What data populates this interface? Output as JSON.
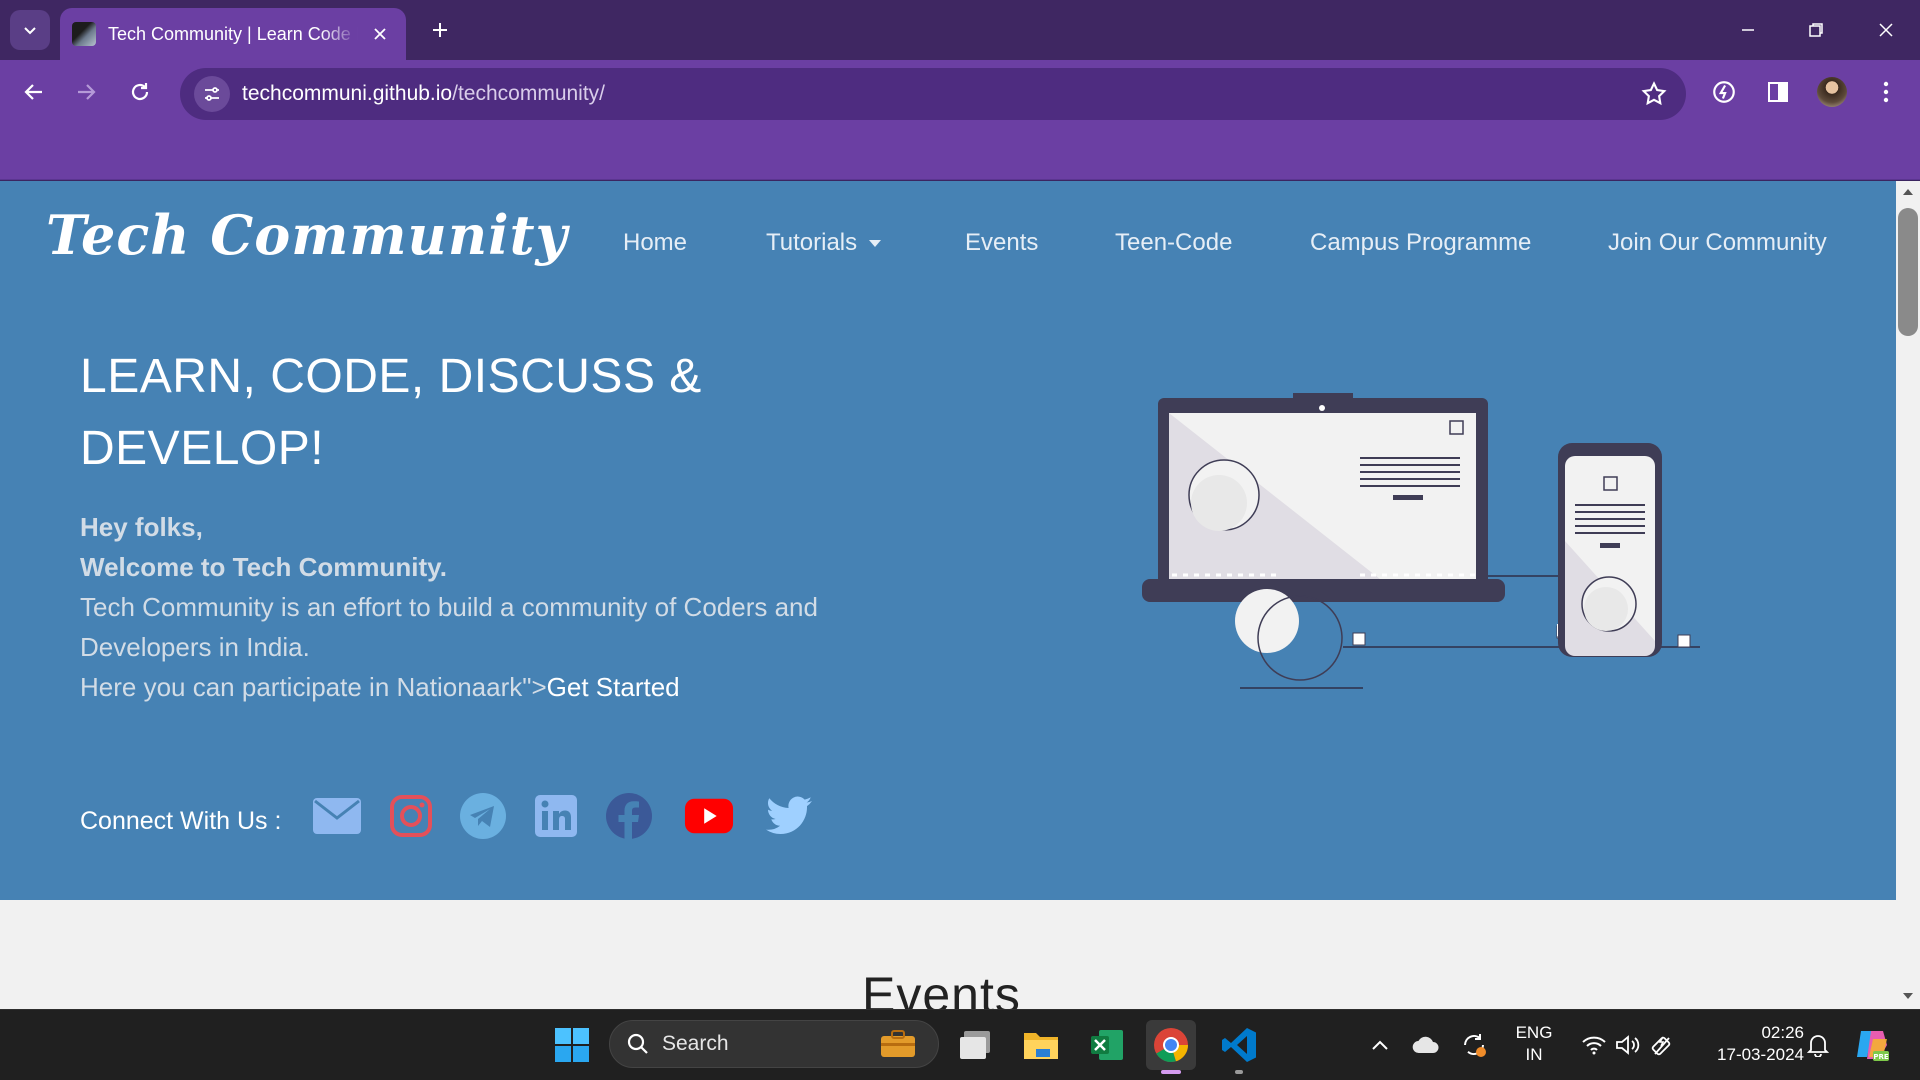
{
  "browser": {
    "tab_title": "Tech Community | Learn Code D",
    "url_host": "techcommuni.github.io",
    "url_path": "/techcommunity/"
  },
  "site": {
    "brand": "Tech Community",
    "nav": [
      {
        "label": "Home"
      },
      {
        "label": "Tutorials"
      },
      {
        "label": "Events"
      },
      {
        "label": "Teen-Code"
      },
      {
        "label": "Campus Programme"
      },
      {
        "label": "Join Our Community"
      }
    ],
    "hero": {
      "headline_line1": "LEARN, CODE, DISCUSS &",
      "headline_line2": "DEVELOP!",
      "greeting": "Hey folks,",
      "welcome": "Welcome to Tech Community.",
      "description": "Tech Community is an effort to build a community of Coders and Developers in India.",
      "participate_prefix": "Here you can participate in Nationaark\">",
      "get_started": "Get Started",
      "connect_label": "Connect With Us :"
    },
    "social": [
      {
        "name": "email",
        "color": "#8fb8f0"
      },
      {
        "name": "instagram",
        "color": "#e4505a"
      },
      {
        "name": "telegram",
        "color": "#6ab0e0"
      },
      {
        "name": "linkedin",
        "color": "#8fb8f0"
      },
      {
        "name": "facebook",
        "color": "#3b5998"
      },
      {
        "name": "youtube",
        "color": "#ff0000"
      },
      {
        "name": "twitter",
        "color": "#9fd0ff"
      }
    ],
    "events_heading": "Events"
  },
  "taskbar": {
    "search_label": "Search",
    "lang_line1": "ENG",
    "lang_line2": "IN",
    "time": "02:26",
    "date": "17-03-2024"
  },
  "colors": {
    "hero_bg": "#4682b4",
    "browser_frame": "#6b3fa3"
  }
}
